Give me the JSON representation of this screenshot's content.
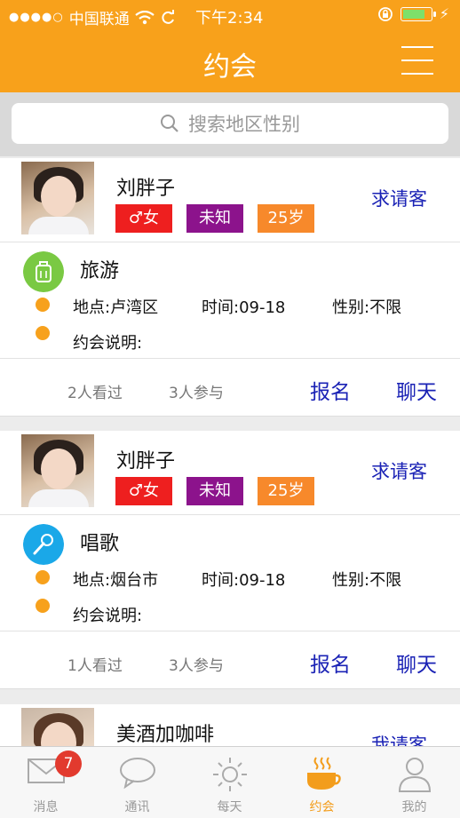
{
  "status_bar": {
    "carrier": "中国联通",
    "time": "下午2:34"
  },
  "nav": {
    "title": "约会"
  },
  "search": {
    "placeholder": "搜索地区性别"
  },
  "cards": [
    {
      "name": "刘胖子",
      "gender": "♂女",
      "status": "未知",
      "age": "25岁",
      "ask": "求请客",
      "category": "旅游",
      "location": "地点:卢湾区",
      "time": "时间:09-18",
      "gender_req": "性别:不限",
      "desc": "约会说明:",
      "views": "2人看过",
      "joins": "3人参与",
      "signup": "报名",
      "chat": "聊天"
    },
    {
      "name": "刘胖子",
      "gender": "♂女",
      "status": "未知",
      "age": "25岁",
      "ask": "求请客",
      "category": "唱歌",
      "location": "地点:烟台市",
      "time": "时间:09-18",
      "gender_req": "性别:不限",
      "desc": "约会说明:",
      "views": "1人看过",
      "joins": "3人参与",
      "signup": "报名",
      "chat": "聊天"
    },
    {
      "name": "美酒加咖啡",
      "ask": "我请客"
    }
  ],
  "tabbar": {
    "items": [
      {
        "label": "消息",
        "icon": "mail-icon",
        "badge": "7"
      },
      {
        "label": "通讯",
        "icon": "chat-bubble-icon"
      },
      {
        "label": "每天",
        "icon": "sun-icon"
      },
      {
        "label": "约会",
        "icon": "coffee-cup-icon"
      },
      {
        "label": "我的",
        "icon": "person-icon"
      }
    ],
    "active": "约会"
  },
  "colors": {
    "brand": "#f8a11b",
    "link": "#1a22b5",
    "travel_icon": "#7ac943",
    "sing_icon": "#1aa8e8"
  }
}
